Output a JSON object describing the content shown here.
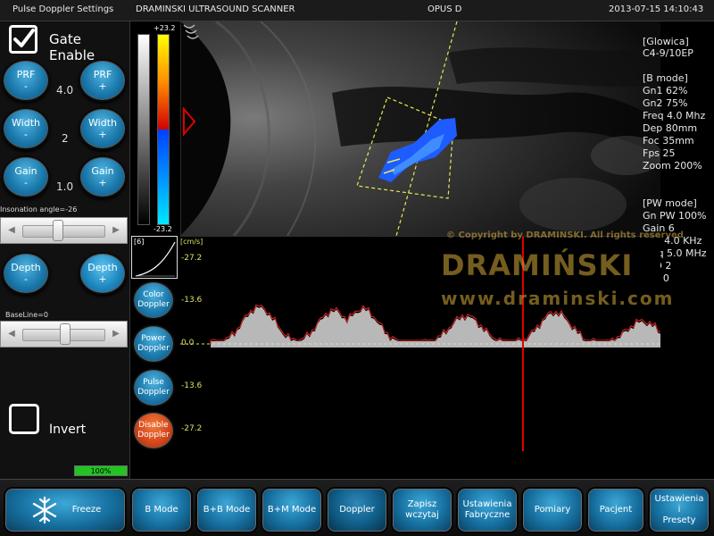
{
  "topbar": {
    "section": "Pulse Doppler  Settings",
    "app_title": "DRAMINSKI ULTRASOUND SCANNER",
    "model": "OPUS D",
    "datetime": "2013-07-15 14:10:43"
  },
  "left_panel": {
    "gate_enable_label": "Gate Enable",
    "gate_enable_checked": true,
    "prf_minus": [
      "PRF",
      "-"
    ],
    "prf_plus": [
      "PRF",
      "+"
    ],
    "prf_value": "4.0",
    "width_minus": [
      "Width",
      "-"
    ],
    "width_plus": [
      "Width",
      "+"
    ],
    "width_value": "2",
    "gain_minus": [
      "Gain",
      "-"
    ],
    "gain_plus": [
      "Gain",
      "+"
    ],
    "gain_value": "1.0",
    "insonation_label": "Insonation angle=-26",
    "insonation_level": 0.42,
    "depth_minus": [
      "Depth",
      "-"
    ],
    "depth_plus": [
      "Depth",
      "+"
    ],
    "baseline_label": "BaseLine=0",
    "baseline_level": 0.5,
    "invert_label": "Invert",
    "invert_checked": false,
    "progress_text": "100%",
    "progress_value": 1.0
  },
  "colorbar": {
    "top_value": "+23.2",
    "bottom_value": "-23.2"
  },
  "info": {
    "probe_header": "[Glowica]",
    "probe": "C4-9/10EP",
    "bmode_header": "[B mode]",
    "gn1": "Gn1 62%",
    "gn2": "Gn2 75%",
    "freq": "Freq 4.0 Mhz",
    "dep": "Dep 80mm",
    "foc": "Foc 35mm",
    "fps": "Fps 25",
    "zoom": "Zoom 200%",
    "pw_header": "[PW mode]",
    "gn_pw": "Gn PW 100%",
    "gain": "Gain 6",
    "prf": "PRF 4.0 KHz",
    "freq_pw": "Freq 5.0 MHz",
    "avd": "AvD 2",
    "sfd": "SfD 0"
  },
  "doppler": {
    "mini_num": "[6]",
    "unit": "[cm/s]",
    "scale": [
      "-27.2",
      "-13.6",
      "0.0",
      "-13.6",
      "-27.2"
    ],
    "color_doppler": [
      "Color",
      "Doppler"
    ],
    "power_doppler": [
      "Power",
      "Doppler"
    ],
    "pulse_doppler": [
      "Pulse",
      "Doppler"
    ],
    "disable_doppler": [
      "Disable",
      "Doppler"
    ]
  },
  "watermark": {
    "copyright": "© Copyright by DRAMINSKI. All rights reserved",
    "brand": "DRAMIŃSKI",
    "url": "www.draminski.com"
  },
  "bottom": {
    "freeze": "Freeze",
    "b_mode": "B Mode",
    "bb_mode": "B+B Mode",
    "bm_mode": "B+M Mode",
    "doppler": "Doppler",
    "zapisz": [
      "Zapisz",
      "wczytaj"
    ],
    "ustawienia_fabryczne": [
      "Ustawienia",
      "Fabryczne"
    ],
    "pomiary": "Pomiary",
    "pacjent": "Pacjent",
    "ustawienia_presety": [
      "Ustawienia",
      "i",
      "Presety"
    ]
  },
  "colors": {
    "button_blue": "#1a78aa",
    "button_orange": "#d4461a",
    "scale_yellow": "#e0e060",
    "gate_line": "#e8e85a",
    "flow_blue": "#1e5cff",
    "cursor_red": "#e00000"
  }
}
